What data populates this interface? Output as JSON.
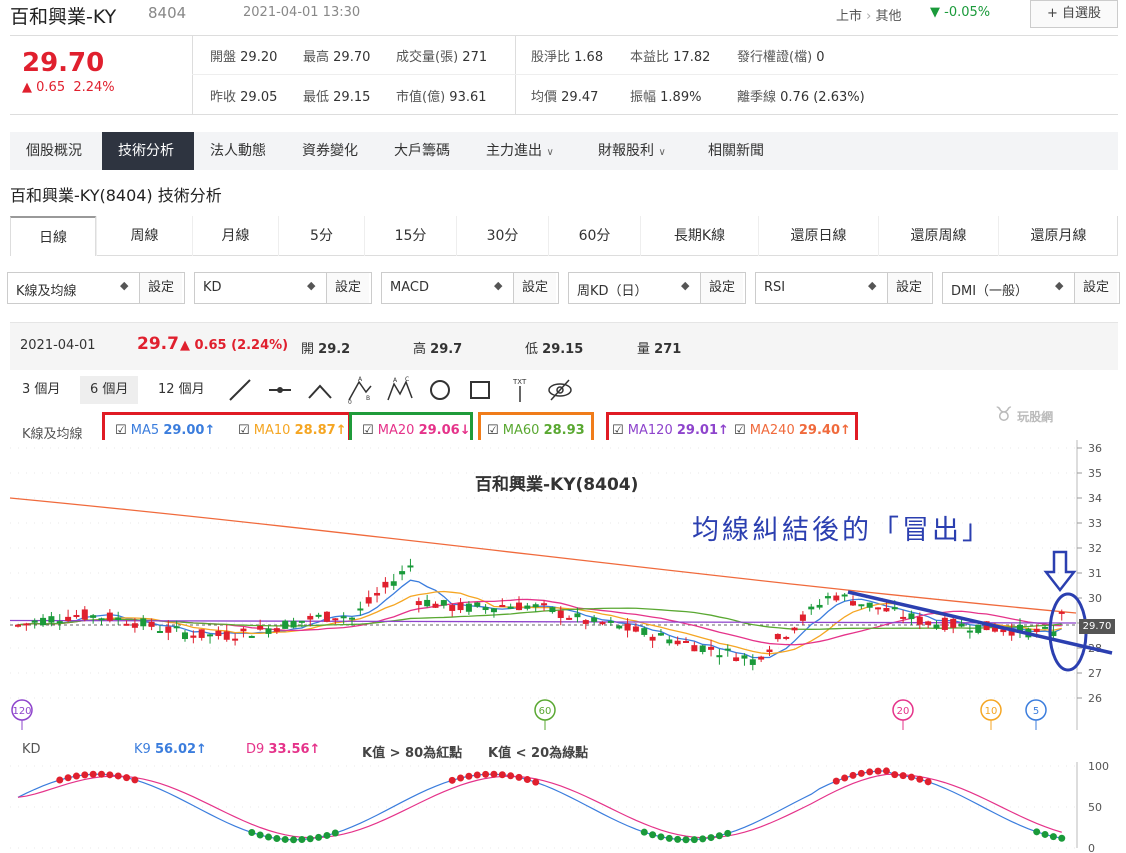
{
  "header": {
    "name": "百和興業-KY",
    "code": "8404",
    "datetime": "2021-04-01 13:30",
    "market": "上市",
    "category": "其他",
    "change_pct": "-0.05%",
    "fav_button": "+ 自選股"
  },
  "quote": {
    "price": "29.70",
    "change": "0.65",
    "change_pct": "2.24%",
    "open_label": "開盤",
    "open": "29.20",
    "high_label": "最高",
    "high": "29.70",
    "vol_label": "成交量(張)",
    "vol": "271",
    "prev_label": "昨收",
    "prev": "29.05",
    "low_label": "最低",
    "low": "29.15",
    "mcap_label": "市值(億)",
    "mcap": "93.61",
    "pb_label": "股淨比",
    "pb": "1.68",
    "pe_label": "本益比",
    "pe": "17.82",
    "warrant_label": "發行權證(檔)",
    "warrant": "0",
    "avg_label": "均價",
    "avg": "29.47",
    "amp_label": "振幅",
    "amp": "1.89%",
    "dev_label": "離季線",
    "dev": "0.76 (2.63%)"
  },
  "nav_tabs": [
    "個股概況",
    "技術分析",
    "法人動態",
    "資券變化",
    "大戶籌碼",
    "主力進出",
    "財報股利",
    "相關新聞"
  ],
  "page_title": "百和興業-KY(8404) 技術分析",
  "period_tabs": [
    "日線",
    "周線",
    "月線",
    "5分",
    "15分",
    "30分",
    "60分",
    "長期K線",
    "還原日線",
    "還原周線",
    "還原月線"
  ],
  "selectors": [
    {
      "label": "K線及均線"
    },
    {
      "label": "KD"
    },
    {
      "label": "MACD"
    },
    {
      "label": "周KD（日）"
    },
    {
      "label": "RSI"
    },
    {
      "label": "DMI（一般）"
    }
  ],
  "set_label": "設定",
  "info": {
    "date": "2021-04-01",
    "price": "29.7",
    "chg": "0.65 (2.24%)",
    "open_label": "開",
    "open": "29.2",
    "high_label": "高",
    "high": "29.7",
    "low_label": "低",
    "low": "29.15",
    "vol_label": "量",
    "vol": "271"
  },
  "range_buttons": [
    "3 個月",
    "6 個月",
    "12 個月"
  ],
  "tool_icons": [
    "line-tool-icon",
    "ray-tool-icon",
    "angle-tool-icon",
    "abc-pattern-icon",
    "abcd-pattern-icon",
    "circle-tool-icon",
    "rect-tool-icon",
    "text-tool-icon",
    "hide-drawings-icon"
  ],
  "text_tool_label": "TXT",
  "ma_legend": {
    "title": "K線及均線",
    "items": [
      {
        "label": "MA5",
        "value": "29.00↑",
        "color": "#3b7ddd"
      },
      {
        "label": "MA10",
        "value": "28.87↑",
        "color": "#f5a623"
      },
      {
        "label": "MA20",
        "value": "29.06↓",
        "color": "#e5338a"
      },
      {
        "label": "MA60",
        "value": "28.93",
        "color": "#5aa832"
      },
      {
        "label": "MA120",
        "value": "29.01↑",
        "color": "#8e44cc"
      },
      {
        "label": "MA240",
        "value": "29.40↑",
        "color": "#f06a3c"
      }
    ]
  },
  "watermark": "玩股網",
  "chart_title": "百和興業-KY(8404)",
  "annotation": "均線糾結後的「冒出」",
  "price_axis": [
    "36",
    "35",
    "34",
    "33",
    "32",
    "31",
    "30",
    "29",
    "28",
    "27",
    "26"
  ],
  "last_price_tag": "29.70",
  "ma_markers": [
    "120",
    "60",
    "20",
    "10",
    "5"
  ],
  "kd": {
    "title": "KD",
    "k_label": "K9",
    "k_value": "56.02↑",
    "d_label": "D9",
    "d_value": "33.56↑",
    "note1": "K值 > 80為紅點",
    "note2": "K值 < 20為綠點",
    "axis": [
      "100",
      "50",
      "0"
    ]
  },
  "colors": {
    "up": "#e0202e",
    "down": "#1a9a3a",
    "annot": "#2b3fb0"
  }
}
